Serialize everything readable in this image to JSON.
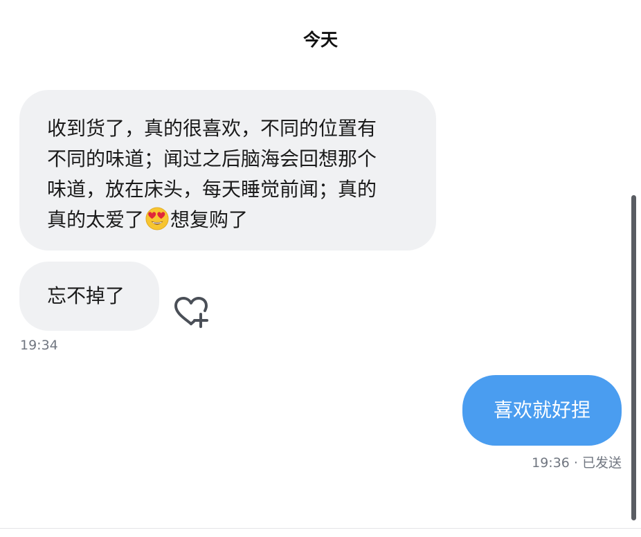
{
  "header": {
    "date_label": "今天"
  },
  "messages": {
    "incoming_1": {
      "lines": [
        "收到货了，真的很喜欢，不同的位置有",
        "不同的味道；闻过之后脑海会回想那个",
        "味道，放在床头，每天睡觉前闻；真的"
      ],
      "last_line_before_emoji": "真的太爱了",
      "emoji": "heart-eyes-emoji",
      "last_line_after_emoji": "想复购了"
    },
    "incoming_2": {
      "text": "忘不掉了"
    },
    "incoming_time": "19:34",
    "reaction_icon": "heart-plus-icon",
    "outgoing_1": {
      "text": "喜欢就好捏"
    },
    "outgoing_status": "19:36 · 已发送"
  },
  "colors": {
    "incoming_bubble": "#f0f1f3",
    "outgoing_bubble": "#4a9df0",
    "timestamp": "#707680"
  }
}
